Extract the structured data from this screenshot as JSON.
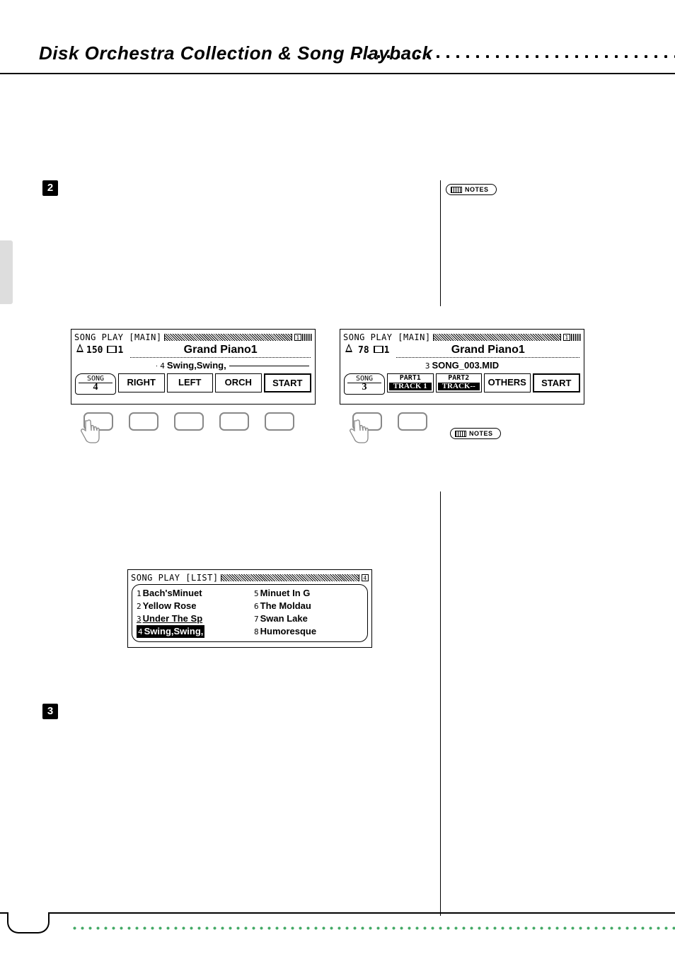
{
  "header": {
    "title": "Disk Orchestra Collection & Song Playback"
  },
  "badges": {
    "step2": "2",
    "step3": "3",
    "notes_label": "NOTES"
  },
  "lcd_left": {
    "mode": "SONG PLAY [MAIN]",
    "page": "1",
    "tempo": "150",
    "measure": "1",
    "voice": "Grand Piano1",
    "song_row_num": "4",
    "song_row_name": "Swing,Swing,",
    "song_tab_label": "SONG",
    "song_tab_num": "4",
    "b1": "RIGHT",
    "b2": "LEFT",
    "b3": "ORCH",
    "b4": "START"
  },
  "lcd_right": {
    "mode": "SONG PLAY [MAIN]",
    "page": "1",
    "tempo": "78",
    "measure": "1",
    "voice": "Grand Piano1",
    "song_row_num": "3",
    "song_row_name": "SONG_003.MID",
    "song_tab_label": "SONG",
    "song_tab_num": "3",
    "p1_top": "PART1",
    "p1_bot": "TRACK 1",
    "p2_top": "PART2",
    "p2_bot": "TRACK--",
    "b3": "OTHERS",
    "b4": "START"
  },
  "lcd_list": {
    "mode": "SONG PLAY [LIST]",
    "page": "4",
    "col1": [
      {
        "n": "1",
        "t": "Bach'sMinuet"
      },
      {
        "n": "2",
        "t": "Yellow Rose"
      },
      {
        "n": "3",
        "t": "Under The Sp",
        "ul": true
      },
      {
        "n": "4",
        "t": "Swing,Swing,",
        "hl": true
      }
    ],
    "col2": [
      {
        "n": "5",
        "t": "Minuet In G"
      },
      {
        "n": "6",
        "t": "The Moldau"
      },
      {
        "n": "7",
        "t": "Swan Lake"
      },
      {
        "n": "8",
        "t": "Humoresque"
      }
    ]
  }
}
